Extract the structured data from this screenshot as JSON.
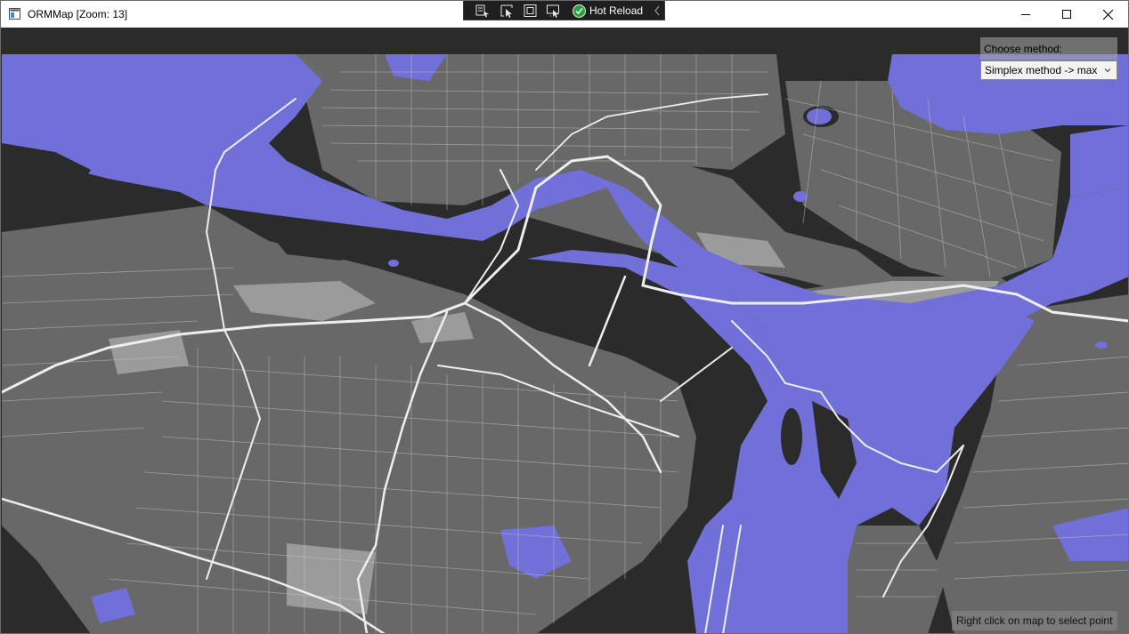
{
  "window": {
    "title": "ORMMap [Zoom: 13]",
    "app_icon": "window-app-icon",
    "controls": {
      "minimize_icon": "minimize-icon",
      "maximize_icon": "maximize-icon",
      "close_icon": "close-icon"
    }
  },
  "debug_toolbar": {
    "icons": [
      "live-visual-tree-icon",
      "select-element-icon",
      "display-layout-adorners-icon",
      "track-focus-icon"
    ],
    "hot_reload_label": "Hot Reload",
    "hot_reload_status_icon": "check-circle-icon",
    "collapse_icon": "chevron-left-icon"
  },
  "map": {
    "zoom": 13,
    "colors": {
      "land": "#2b2b2b",
      "water": "#7070d8",
      "blocks": "#7a7a7a",
      "roads": "#d8d8d8",
      "major_roads": "#f2f2f2"
    }
  },
  "method_selector": {
    "label": "Choose method:",
    "selected_value": "Simplex method -> max",
    "chevron_icon": "chevron-down-icon"
  },
  "hint": {
    "text": "Right click on map to select point"
  }
}
